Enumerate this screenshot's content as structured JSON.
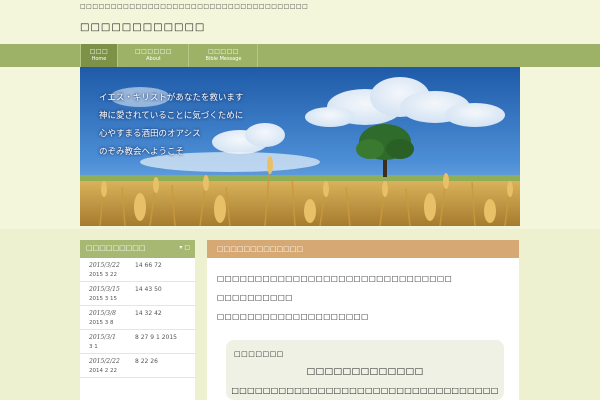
{
  "header": {
    "tagline": "□□□□□□□□□□□□□□□□□□□□□□□□□□□□□□□□□□□□□",
    "site_title": "□□□□□□□□□□□□"
  },
  "nav": {
    "items": [
      {
        "label": "□□□",
        "sub": "Home",
        "active": true
      },
      {
        "label": "□□□□□□",
        "sub": "About",
        "active": false
      },
      {
        "label": "□□□□□",
        "sub": "Bible Message",
        "active": false
      }
    ]
  },
  "hero": {
    "lines": [
      "イエス・キリストがあなたを救います",
      "神に愛されていることに気づくために",
      "心やすまる酒田のオアシス",
      "のぞみ教会へようこそ"
    ]
  },
  "sidebar": {
    "title": "□□□□□□□□□",
    "toggle": "▾ □",
    "posts": [
      {
        "date": "2015/3/22",
        "nums": "14 66 72",
        "line2": "2015 3 22"
      },
      {
        "date": "2015/3/15",
        "nums": "14 43 50",
        "line2": "2015 3 15"
      },
      {
        "date": "2015/3/8",
        "nums": "14 32 42",
        "line2": "2015 3 8"
      },
      {
        "date": "2015/3/1",
        "nums": "8 27 9 1           2015",
        "line2": "3 1"
      },
      {
        "date": "2015/2/22",
        "nums": "8 22 26",
        "line2": "2014 2 22"
      }
    ]
  },
  "main": {
    "title": "□□□□□□□□□□□□□",
    "paragraphs": [
      "□□□□□□□□□□□□□□□□□□□□□□□□□□□□□□□",
      "□□□□□□□□□□",
      "□□□□□□□□□□□□□□□□□□□□"
    ],
    "box": {
      "label": "□□□□□□□",
      "line1": "□□□□□□□□□□□□□",
      "line2": "□□□□□□□□□□□□□□□□□□□□□□□□□□□□□□□□□□"
    }
  },
  "colors": {
    "page_bg": "#f3f6da",
    "nav_bg": "#9db267",
    "nav_active": "#7d9246",
    "sidebar_head": "#a7b872",
    "main_head": "#d6a873"
  }
}
